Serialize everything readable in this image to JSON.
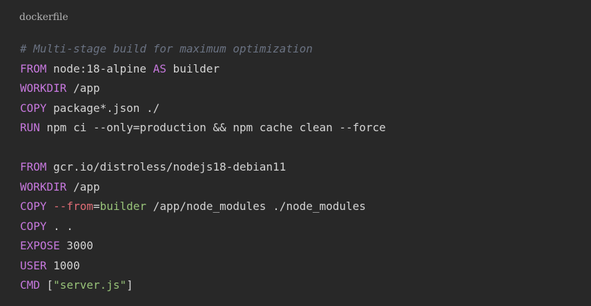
{
  "code_block": {
    "language": "dockerfile",
    "lines": [
      [
        {
          "t": "# Multi-stage build for maximum optimization",
          "c": "comment"
        }
      ],
      [
        {
          "t": "FROM",
          "c": "kw"
        },
        {
          "t": " node:18-alpine ",
          "c": "txt"
        },
        {
          "t": "AS",
          "c": "kw"
        },
        {
          "t": " builder",
          "c": "txt"
        }
      ],
      [
        {
          "t": "WORKDIR",
          "c": "kw"
        },
        {
          "t": " /app",
          "c": "txt"
        }
      ],
      [
        {
          "t": "COPY",
          "c": "kw"
        },
        {
          "t": " package*.json ./",
          "c": "txt"
        }
      ],
      [
        {
          "t": "RUN",
          "c": "kw"
        },
        {
          "t": " npm ci --only=production && npm cache clean --force",
          "c": "txt"
        }
      ],
      [],
      [
        {
          "t": "FROM",
          "c": "kw"
        },
        {
          "t": " gcr.io/distroless/nodejs18-debian11",
          "c": "txt"
        }
      ],
      [
        {
          "t": "WORKDIR",
          "c": "kw"
        },
        {
          "t": " /app",
          "c": "txt"
        }
      ],
      [
        {
          "t": "COPY",
          "c": "kw"
        },
        {
          "t": " ",
          "c": "txt"
        },
        {
          "t": "--from",
          "c": "flag"
        },
        {
          "t": "=",
          "c": "txt"
        },
        {
          "t": "builder",
          "c": "str"
        },
        {
          "t": " /app/node_modules ./node_modules",
          "c": "txt"
        }
      ],
      [
        {
          "t": "COPY",
          "c": "kw"
        },
        {
          "t": " . .",
          "c": "txt"
        }
      ],
      [
        {
          "t": "EXPOSE",
          "c": "kw"
        },
        {
          "t": " 3000",
          "c": "num"
        }
      ],
      [
        {
          "t": "USER",
          "c": "kw"
        },
        {
          "t": " 1000",
          "c": "num"
        }
      ],
      [
        {
          "t": "CMD",
          "c": "kw"
        },
        {
          "t": " [",
          "c": "txt"
        },
        {
          "t": "\"server.js\"",
          "c": "str"
        },
        {
          "t": "]",
          "c": "txt"
        }
      ]
    ]
  }
}
